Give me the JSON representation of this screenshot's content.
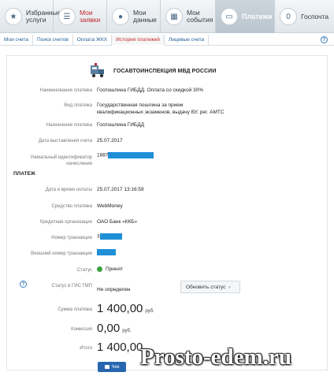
{
  "nav": {
    "tabs": [
      {
        "label": "Избранные\nуслуги",
        "icon": "service-icon"
      },
      {
        "label": "Мои\nзаявки",
        "icon": "requests-icon"
      },
      {
        "label": "Мои\nданные",
        "icon": "user-icon"
      },
      {
        "label": "Мои\nсобытия",
        "icon": "calendar-icon"
      },
      {
        "label": "Платежи",
        "icon": "wallet-icon"
      },
      {
        "label": "Госпочта",
        "icon": "mail-icon"
      }
    ],
    "badge_count": "0"
  },
  "subnav": {
    "tabs": [
      "Мои счета",
      "Поиск счетов",
      "Оплата ЖКХ",
      "История платежей",
      "Лицевые счета"
    ]
  },
  "org": {
    "name": "ГОСАВТОИНСПЕКЦИЯ МВД РОССИИ"
  },
  "details": {
    "name_label": "Наименование платежа",
    "name_value": "Госпошлина ГИБДД. Оплата со скидкой 30%",
    "type_label": "Вид платежа",
    "type_value": "Государственная пошлина за прием квалификационных экзаменов, выдачу ВУ, рег. АМТС",
    "purpose_label": "Назначение платежа",
    "purpose_value": "Госпошлина ГИБДД",
    "date_label": "Дата выставления счета",
    "date_value": "25.07.2017",
    "uid_label": "Уникальный идентификатор\nначисления",
    "uid_value": "1887"
  },
  "payment": {
    "section": "ПЛАТЕЖ",
    "datetime_label": "Дата и время оплаты",
    "datetime_value": "25.07.2017 13:16:59",
    "method_label": "Средство платежа",
    "method_value": "WebMoney",
    "bank_label": "Кредитная организация",
    "bank_value": "ОАО Банк «ККБ»",
    "tx_label": "Номер транзакции",
    "tx_value": "3",
    "ext_tx_label": "Внешний номер транзакции",
    "status_label": "Статус",
    "status_value": "Принят",
    "gis_label": "Статус в ГИС ГМП",
    "gis_value": "Не определен",
    "update_button": "Обновить статус",
    "sum_label": "Сумма платежа",
    "sum_value": "1 400,00",
    "fee_label": "Комиссия",
    "fee_value": "0,00",
    "total_label": "Итого",
    "total_value": "1 400,00",
    "currency": "руб.",
    "check_button": "Чек"
  },
  "watermark": "Prosto-edem.ru",
  "colors": {
    "accent": "#c2282a",
    "link": "#1f5f96",
    "button": "#2866b0",
    "status_ok": "#3ca041",
    "redaction": "#1f8fd6"
  }
}
